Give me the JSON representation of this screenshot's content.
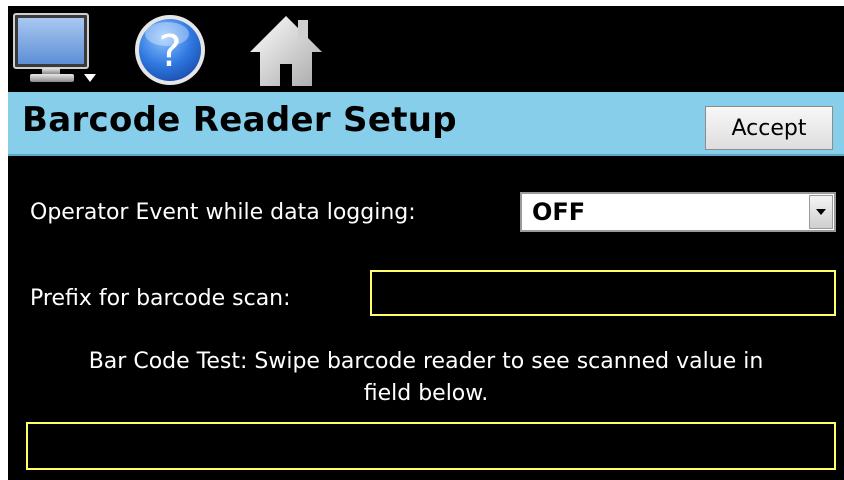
{
  "toolbar": {
    "icons": [
      "monitor-icon",
      "help-icon",
      "home-icon"
    ]
  },
  "header": {
    "title": "Barcode Reader Setup",
    "accept_label": "Accept"
  },
  "form": {
    "operator_event_label": "Operator Event while data logging:",
    "operator_event_value": "OFF",
    "prefix_label": "Prefix for barcode scan:",
    "prefix_value": "",
    "test_line1": "Bar Code Test:  Swipe barcode reader to see scanned value in",
    "test_line2": "field below.",
    "test_value": ""
  },
  "colors": {
    "header_bg": "#87ceeb",
    "field_border": "#ffff66",
    "screen_bg": "#000000"
  }
}
